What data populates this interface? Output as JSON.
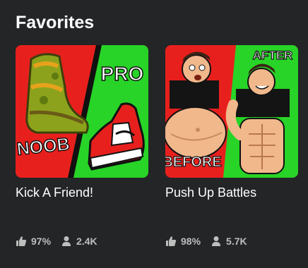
{
  "section": {
    "title": "Favorites"
  },
  "games": [
    {
      "title": "Kick A Friend!",
      "rating": "97%",
      "players": "2.4K",
      "thumbnail": {
        "label_top": "PRO",
        "label_bottom": "NOOB",
        "left_bg": "#e8201d",
        "right_bg": "#28d427"
      }
    },
    {
      "title": "Push Up Battles",
      "rating": "98%",
      "players": "5.7K",
      "thumbnail": {
        "label_top": "AFTER",
        "label_bottom": "BEFORE",
        "left_bg": "#e8201d",
        "right_bg": "#28d427"
      }
    }
  ],
  "icons": {
    "rating": "thumbs-up-icon",
    "players": "person-icon"
  },
  "colors": {
    "background": "#232527",
    "text": "#ffffff",
    "muted": "#bdbebe"
  }
}
